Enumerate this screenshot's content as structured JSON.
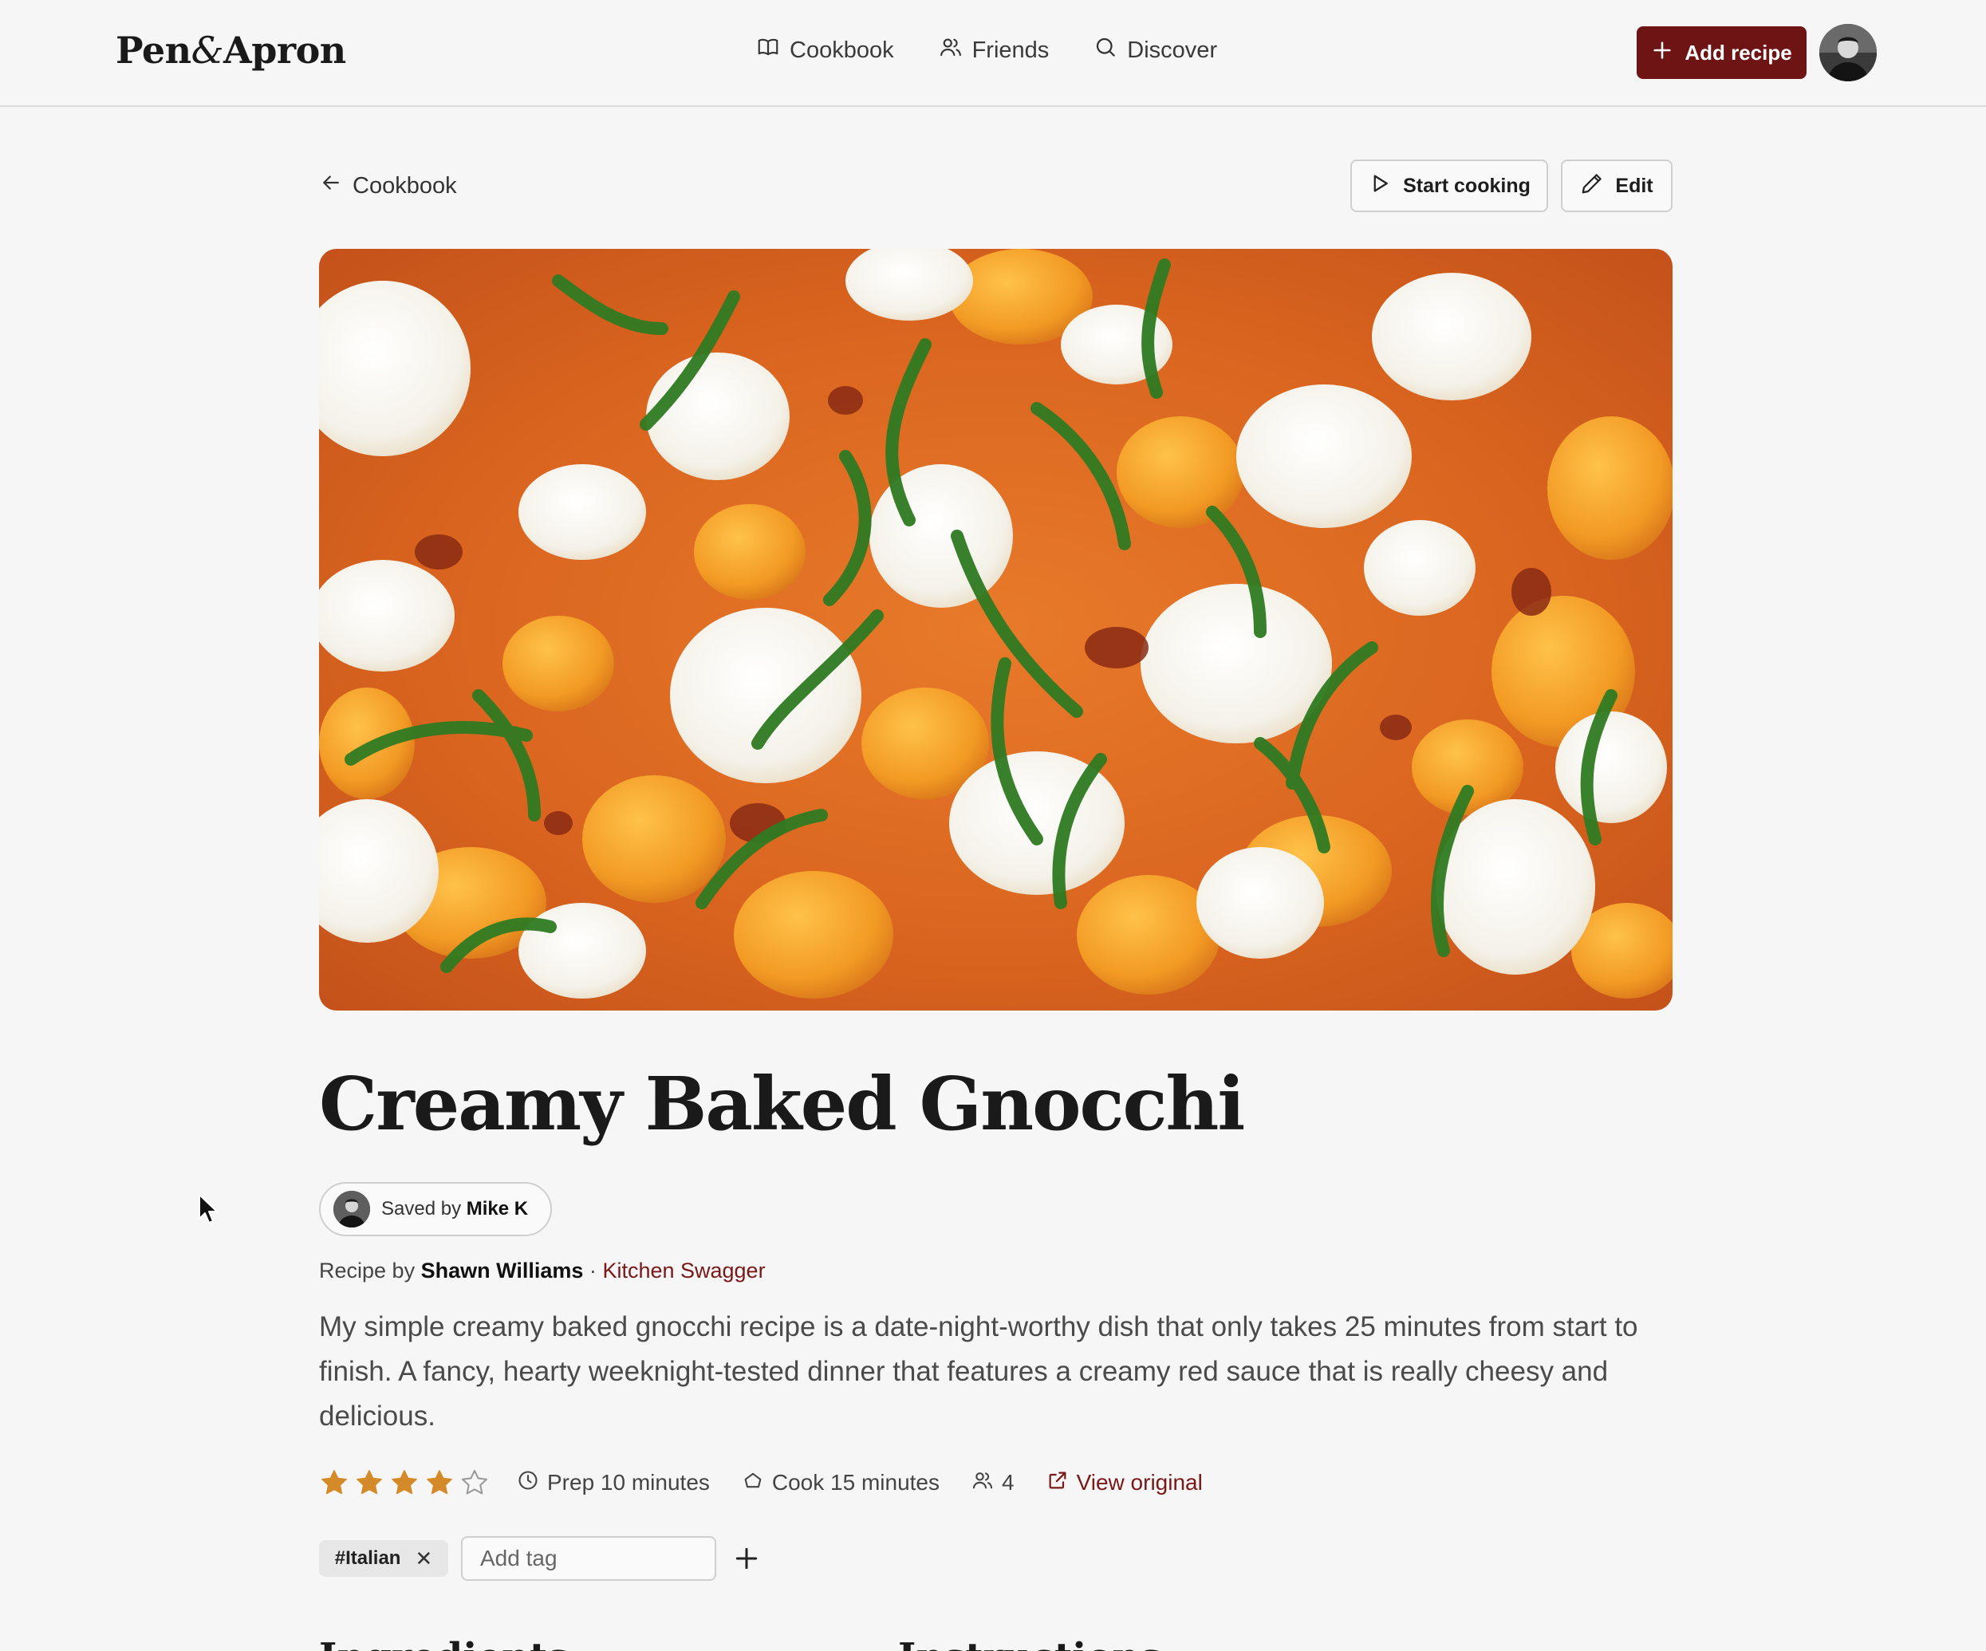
{
  "header": {
    "logo_left": "Pen",
    "logo_amp": "&",
    "logo_right": "Apron",
    "nav": [
      {
        "label": "Cookbook",
        "icon": "book-icon"
      },
      {
        "label": "Friends",
        "icon": "users-icon"
      },
      {
        "label": "Discover",
        "icon": "search-icon"
      }
    ],
    "add_recipe_label": "Add recipe"
  },
  "back_label": "Cookbook",
  "actions": {
    "start_cooking_label": "Start cooking",
    "edit_label": "Edit"
  },
  "recipe": {
    "title": "Creamy Baked Gnocchi",
    "saved_prefix": "Saved by",
    "saved_by": "Mike K",
    "byline_prefix": "Recipe by",
    "author": "Shawn Williams",
    "separator": "·",
    "source": "Kitchen Swagger",
    "description": "My simple creamy baked gnocchi recipe is a date-night-worthy dish that only takes 25 minutes from start to finish. A fancy, hearty weeknight-tested dinner that features a creamy red sauce that is really cheesy and delicious.",
    "rating": 4,
    "rating_max": 5,
    "prep": "Prep 10 minutes",
    "cook": "Cook 15 minutes",
    "servings": "4",
    "view_original": "View original"
  },
  "tags": {
    "items": [
      "#Italian"
    ],
    "add_placeholder": "Add tag"
  },
  "sections": {
    "ingredients": "Ingredients",
    "instructions": "Instructions"
  },
  "colors": {
    "accent": "#6e1414",
    "link": "#7a1818",
    "star": "#d58a2a",
    "background": "#f6f6f6"
  }
}
